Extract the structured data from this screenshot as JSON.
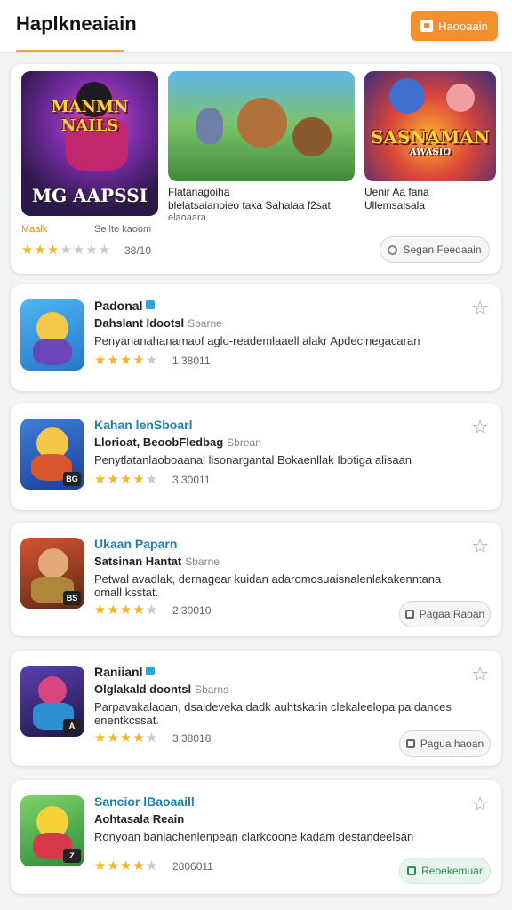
{
  "header": {
    "title": "Haplkneaiain",
    "button_label": "Haooaain"
  },
  "featured": {
    "tiles": [
      {
        "art_top": "MANMN NAILS",
        "art_bottom": "MG AAPSSI",
        "caption": "",
        "caption2": ""
      },
      {
        "art_top": "",
        "art_bottom": "",
        "caption": "Flatanagoiha",
        "caption2": "blelatsaianoieo taka Sahalaa f2sat"
      },
      {
        "art_top": "SASNAMAN",
        "art_bottom": "AWASIO",
        "caption": "Uenir Aa fana",
        "caption2": "Ullemsalsala"
      }
    ],
    "sub_left": "Maalk",
    "sub_mid": "Se lte kaoom",
    "sub_under": "elaoaara",
    "rating": "38/10",
    "action": "Segan Feedaain"
  },
  "items": [
    {
      "title": "Padonal",
      "verified": true,
      "title_blue": false,
      "subtitle": "Dahslant ldootsl",
      "tag": "Sbarne",
      "description": "Penyananahanamaof aglo-reademlaaell alakr Apdecinegacaran",
      "rating": "1.38011",
      "badge": "",
      "action": "",
      "colors": [
        "#37a6e8",
        "#f5c94a"
      ]
    },
    {
      "title": "Kahan lenSboarl",
      "verified": false,
      "title_blue": true,
      "subtitle": "Llorioat, BeoobFledbag",
      "tag": "Sbrean",
      "description": "Penytlatanlaoboaanal lisonargantal Bokaenllak Ibotiga alisaan",
      "rating": "3.30011",
      "badge": "BG",
      "action": "",
      "colors": [
        "#2d5fc4",
        "#f3c548"
      ]
    },
    {
      "title": "Ukaan Paparn",
      "verified": false,
      "title_blue": true,
      "subtitle": "Satsinan Hantat",
      "tag": "Sbarne",
      "description": "Petwal avadlak, dernagear kuidan adaromosuaisnalenlakakenntana omall ksstat.",
      "rating": "2.30010",
      "badge": "BS",
      "action": "Pagaa Raoan",
      "colors": [
        "#c9402e",
        "#6b3a1e"
      ]
    },
    {
      "title": "Raniianl",
      "verified": true,
      "title_blue": false,
      "subtitle": "Olglakald doontsl",
      "tag": "Sbarns",
      "description": "Parpavakalaoan, dsaldeveka dadk auhtskarin clekaleelopa pa dances enentkcssat.",
      "rating": "3.38018",
      "badge": "A",
      "action": "Pagua haoan",
      "colors": [
        "#3a2d7a",
        "#d8457d"
      ]
    },
    {
      "title": "Sancior lBaoaaill",
      "verified": false,
      "title_blue": true,
      "subtitle": "Aohtasala Reain",
      "tag": "",
      "description": "Ronyoan banlachenlenpean clarkcoone kadam destandeelsan",
      "rating": "2806011",
      "badge": "Z",
      "action": "Reoekemuar",
      "colors": [
        "#4bb84b",
        "#f5d238"
      ]
    }
  ]
}
